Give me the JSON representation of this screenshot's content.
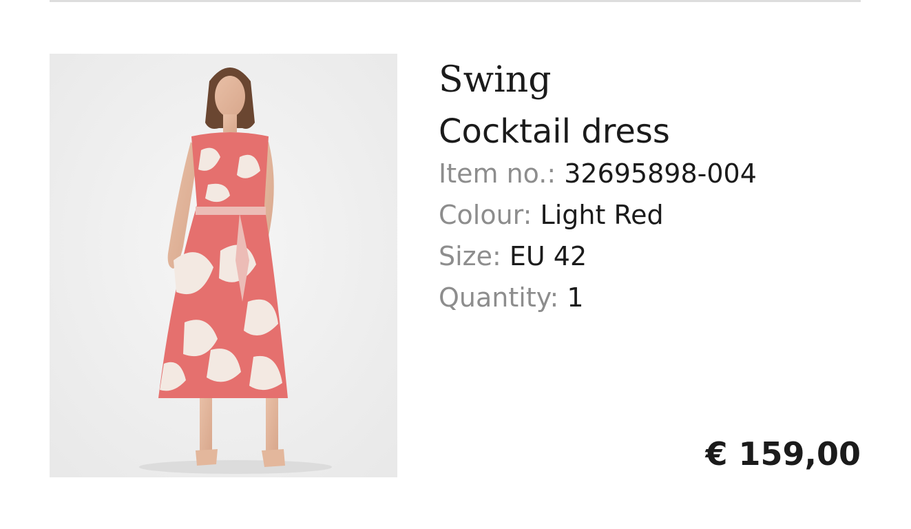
{
  "product": {
    "brand": "Swing",
    "name": "Cocktail dress",
    "item_no_label": "Item no.:",
    "item_no_value": "32695898-004",
    "colour_label": "Colour:",
    "colour_value": "Light Red",
    "size_label": "Size:",
    "size_value": "EU 42",
    "quantity_label": "Quantity:",
    "quantity_value": "1",
    "price": "€ 159,00"
  }
}
